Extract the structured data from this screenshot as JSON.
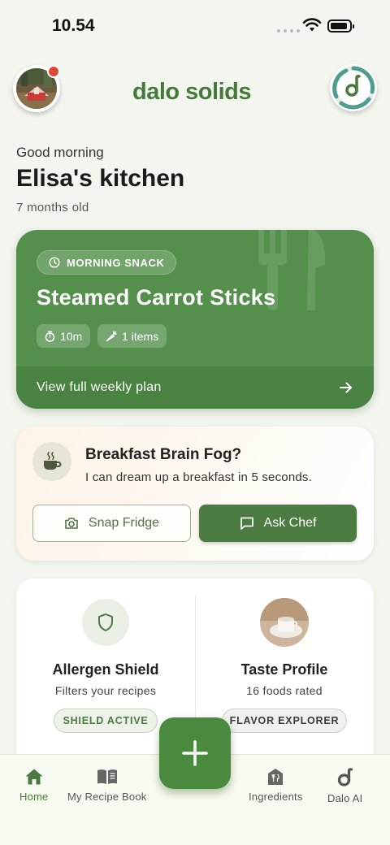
{
  "status_bar": {
    "time": "10.54"
  },
  "header": {
    "logo_text": "dalo solids",
    "notification": true
  },
  "greeting": {
    "salutation": "Good morning",
    "kitchen_name": "Elisa's kitchen",
    "age": "7 months old"
  },
  "meal_card": {
    "tag": "MORNING SNACK",
    "title": "Steamed Carrot Sticks",
    "duration": "10m",
    "items": "1 items",
    "footer_label": "View full weekly plan"
  },
  "chef_card": {
    "title": "Breakfast Brain Fog?",
    "subtitle": "I can dream up a breakfast in 5 seconds.",
    "snap_label": "Snap Fridge",
    "ask_label": "Ask Chef"
  },
  "features": {
    "allergen": {
      "title": "Allergen Shield",
      "subtitle": "Filters your recipes",
      "badge": "SHIELD ACTIVE"
    },
    "taste": {
      "title": "Taste Profile",
      "subtitle": "16 foods rated",
      "badge": "FLAVOR EXPLORER"
    }
  },
  "nav": {
    "items": [
      {
        "label": "Home",
        "icon": "home-icon",
        "active": true
      },
      {
        "label": "My Recipe Book",
        "icon": "book-icon",
        "active": false
      },
      {
        "label": "Ingredients",
        "icon": "ingredients-icon",
        "active": false
      },
      {
        "label": "Dalo AI",
        "icon": "dalo-ai-icon",
        "active": false
      }
    ],
    "fab_icon": "plus-icon"
  },
  "colors": {
    "brand_green": "#467a3a",
    "card_green": "#54904b",
    "notification_red": "#e04836"
  }
}
